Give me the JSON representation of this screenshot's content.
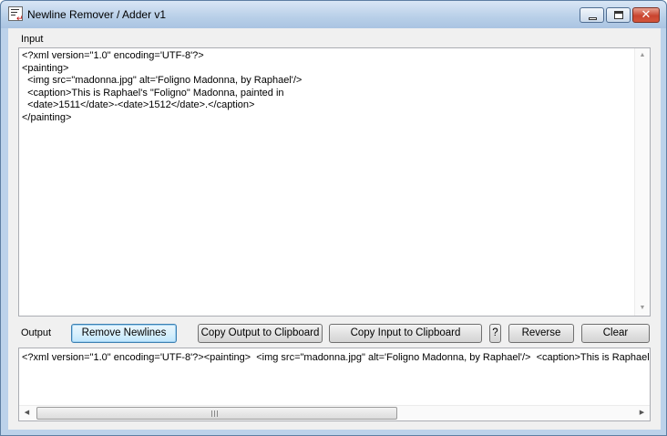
{
  "window": {
    "title": "Newline Remover / Adder v1",
    "icon": "app-document-icon",
    "controls": {
      "minimize": "minimize-icon",
      "maximize": "maximize-icon",
      "close": "✕"
    }
  },
  "input": {
    "label": "Input",
    "lines": [
      "<?xml version=\"1.0\" encoding='UTF-8'?>",
      "<painting>",
      "  <img src=\"madonna.jpg\" alt='Foligno Madonna, by Raphael'/>",
      "  <caption>This is Raphael's \"Foligno\" Madonna, painted in",
      "  <date>1511</date>-<date>1512</date>.</caption>",
      "</painting>"
    ],
    "scroll_up": "▲",
    "scroll_down": "▼"
  },
  "toolbar": {
    "output_label": "Output",
    "remove_newlines": "Remove Newlines",
    "copy_output": "Copy Output to Clipboard",
    "copy_input": "Copy Input to Clipboard",
    "help": "?",
    "reverse": "Reverse",
    "clear": "Clear"
  },
  "output": {
    "text": "<?xml version=\"1.0\" encoding='UTF-8'?><painting>  <img src=\"madonna.jpg\" alt='Foligno Madonna, by Raphael'/>  <caption>This is Raphael's \"Foligno\" Madonna, painted in  <date>1511</date>-<date>1512</date>.</caption></painting>",
    "scroll_left": "◀",
    "scroll_right": "▶"
  }
}
